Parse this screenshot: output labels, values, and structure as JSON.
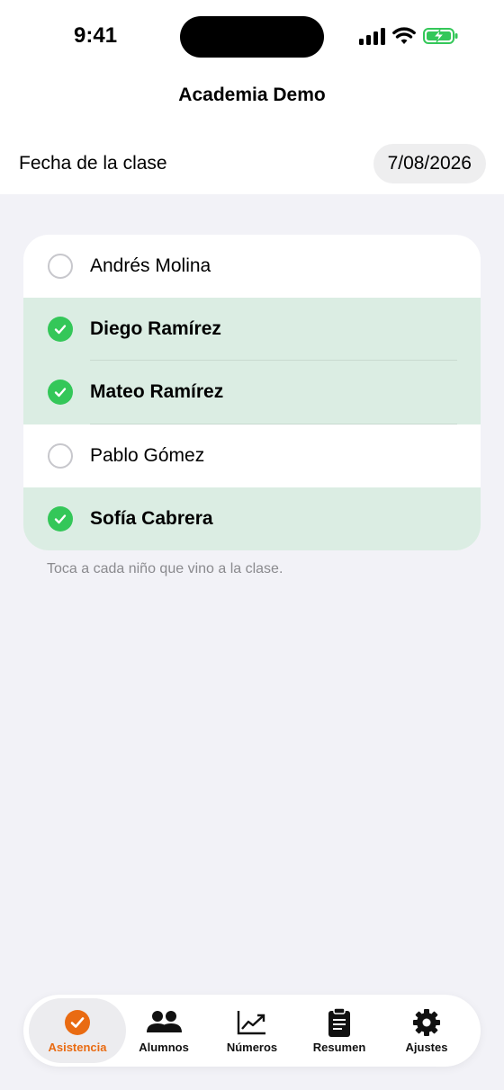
{
  "status_bar": {
    "time": "9:41"
  },
  "nav": {
    "title": "Academia Demo"
  },
  "date_row": {
    "label": "Fecha de la clase",
    "value": "7/08/2026"
  },
  "students": [
    {
      "name": "Andrés Molina",
      "present": false
    },
    {
      "name": "Diego Ramírez",
      "present": true
    },
    {
      "name": "Mateo Ramírez",
      "present": true
    },
    {
      "name": "Pablo Gómez",
      "present": false
    },
    {
      "name": "Sofía Cabrera",
      "present": true
    }
  ],
  "hint": "Toca a cada niño que vino a la clase.",
  "tabs": [
    {
      "label": "Asistencia",
      "icon": "checkmark-circle-icon",
      "active": true
    },
    {
      "label": "Alumnos",
      "icon": "people-icon"
    },
    {
      "label": "Números",
      "icon": "chart-icon"
    },
    {
      "label": "Resumen",
      "icon": "clipboard-icon"
    },
    {
      "label": "Ajustes",
      "icon": "gear-icon"
    }
  ],
  "colors": {
    "accent": "#e96b12",
    "present_green": "#34c759",
    "present_row": "#dbede3",
    "background": "#f2f2f7"
  }
}
